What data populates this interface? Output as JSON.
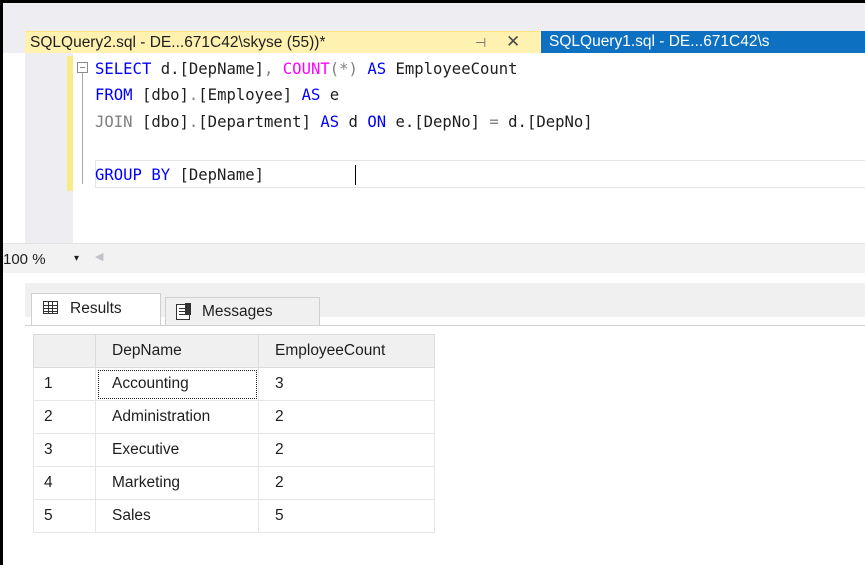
{
  "tabs": {
    "active": {
      "title": "SQLQuery2.sql - DE...671C42\\skyse (55))*",
      "pin_glyph": "⊣",
      "close_glyph": "✕"
    },
    "inactive": {
      "title": "SQLQuery1.sql - DE...671C42\\s"
    }
  },
  "editor": {
    "lines": [
      [
        {
          "t": "SELECT",
          "c": "kw"
        },
        {
          "t": " d.",
          "c": "txt"
        },
        {
          "t": "[DepName]",
          "c": "txt"
        },
        {
          "t": ", ",
          "c": "gray"
        },
        {
          "t": "COUNT",
          "c": "fn"
        },
        {
          "t": "(*) ",
          "c": "gray"
        },
        {
          "t": "AS",
          "c": "kw"
        },
        {
          "t": " EmployeeCount",
          "c": "txt"
        }
      ],
      [
        {
          "t": "FROM",
          "c": "kw"
        },
        {
          "t": " [dbo]",
          "c": "txt"
        },
        {
          "t": ".",
          "c": "gray"
        },
        {
          "t": "[Employee] ",
          "c": "txt"
        },
        {
          "t": "AS",
          "c": "kw"
        },
        {
          "t": " e",
          "c": "txt"
        }
      ],
      [
        {
          "t": "JOIN",
          "c": "gray"
        },
        {
          "t": " [dbo]",
          "c": "txt"
        },
        {
          "t": ".",
          "c": "gray"
        },
        {
          "t": "[Department] ",
          "c": "txt"
        },
        {
          "t": "AS",
          "c": "kw"
        },
        {
          "t": " d ",
          "c": "txt"
        },
        {
          "t": "ON",
          "c": "kw"
        },
        {
          "t": " e.",
          "c": "txt"
        },
        {
          "t": "[DepNo]",
          "c": "txt"
        },
        {
          "t": " = ",
          "c": "gray"
        },
        {
          "t": "d.",
          "c": "txt"
        },
        {
          "t": "[DepNo]",
          "c": "txt"
        }
      ],
      [
        {
          "t": "GROUP BY",
          "c": "kw"
        },
        {
          "t": " [DepName]",
          "c": "txt"
        }
      ]
    ]
  },
  "zoom": {
    "value": "100 %",
    "dropdown_glyph": "▾",
    "scroll_glyph": "◀"
  },
  "results_tabs": {
    "results_label": "Results",
    "messages_label": "Messages"
  },
  "grid": {
    "columns": [
      "",
      "DepName",
      "EmployeeCount"
    ],
    "rows": [
      {
        "num": "1",
        "dep": "Accounting",
        "count": "3"
      },
      {
        "num": "2",
        "dep": "Administration",
        "count": "2"
      },
      {
        "num": "3",
        "dep": "Executive",
        "count": "2"
      },
      {
        "num": "4",
        "dep": "Marketing",
        "count": "2"
      },
      {
        "num": "5",
        "dep": "Sales",
        "count": "5"
      }
    ]
  },
  "colors": {
    "active_tab_bg": "#fff1b0",
    "inactive_tab_bg": "#0e70c0",
    "keyword": "#0000ff",
    "function": "#ff00ff",
    "operator_gray": "#808080"
  }
}
